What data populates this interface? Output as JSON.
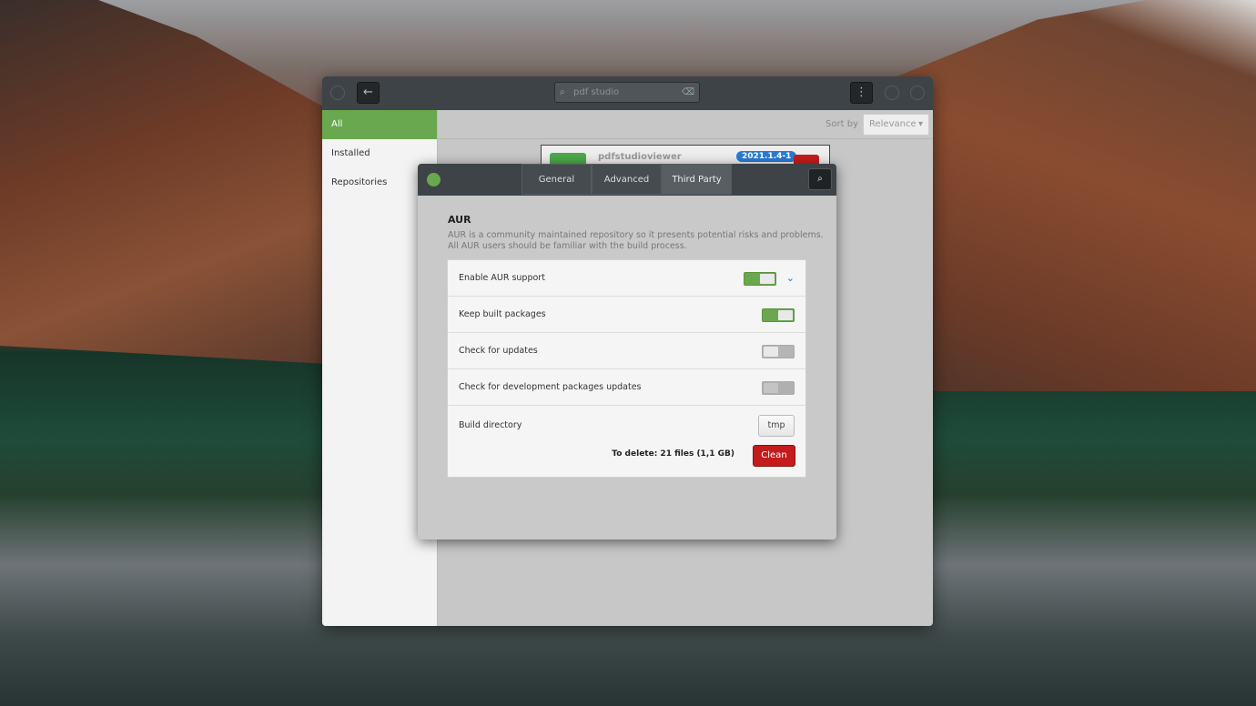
{
  "main_window": {
    "search": {
      "value": "pdf studio"
    },
    "sidebar": [
      {
        "label": "All",
        "active": true
      },
      {
        "label": "Installed"
      },
      {
        "label": "Repositories"
      }
    ],
    "sort": {
      "label": "Sort by",
      "value": "Relevance"
    },
    "package": {
      "name": "pdfstudioviewer",
      "version": "2021.1.4-1"
    }
  },
  "dialog": {
    "tabs": [
      {
        "label": "General"
      },
      {
        "label": "Advanced"
      },
      {
        "label": "Third Party",
        "active": true
      }
    ],
    "section_title": "AUR",
    "description_1": "AUR is a community maintained repository so it presents potential risks and problems.",
    "description_2": "All AUR users should be familiar with the build process.",
    "settings": [
      {
        "label": "Enable AUR support",
        "enabled": true
      },
      {
        "label": "Keep built packages",
        "enabled": true
      },
      {
        "label": "Check for updates",
        "enabled": false
      },
      {
        "label": "Check for development packages updates",
        "enabled": false,
        "disabled": true
      }
    ],
    "build_directory": {
      "label": "Build directory",
      "value": "tmp"
    },
    "to_delete": "To delete:  21 files  (1,1 GB)",
    "clean_label": "Clean",
    "accent": "#6aa84f",
    "danger": "#c41c1c"
  }
}
